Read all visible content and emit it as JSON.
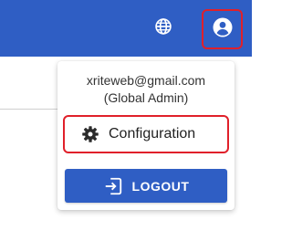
{
  "colors": {
    "header": "#2f5ec4",
    "highlight": "#e0202a",
    "button": "#2f5ec4"
  },
  "header": {
    "icons": [
      "globe-icon",
      "account-circle-icon"
    ]
  },
  "user_menu": {
    "email": "xriteweb@gmail.com",
    "role": "(Global Admin)",
    "configuration": {
      "label": "Configuration",
      "icon": "gear-icon"
    },
    "logout": {
      "label": "LOGOUT",
      "icon": "logout-icon"
    }
  }
}
